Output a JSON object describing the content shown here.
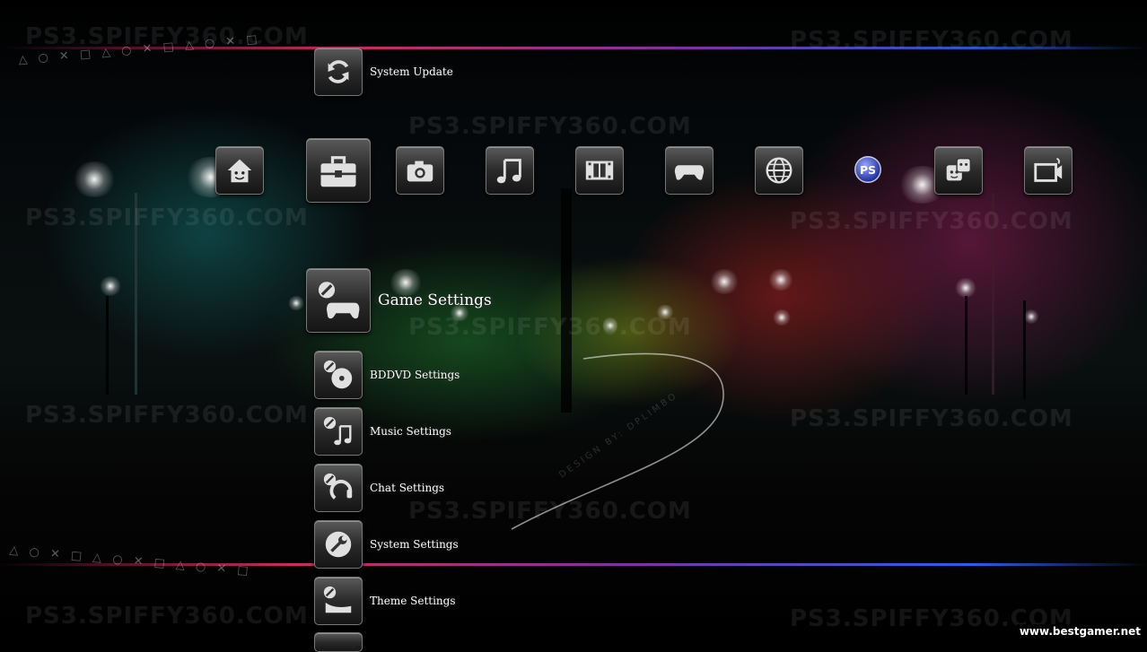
{
  "system_update": {
    "label": "System Update",
    "icon": "refresh-icon"
  },
  "categories": [
    {
      "name": "users",
      "icon": "home-face-icon"
    },
    {
      "name": "settings",
      "icon": "toolbox-icon",
      "selected": true
    },
    {
      "name": "photo",
      "icon": "camera-icon"
    },
    {
      "name": "music",
      "icon": "music-note-icon"
    },
    {
      "name": "video",
      "icon": "film-icon"
    },
    {
      "name": "game",
      "icon": "gamepad-icon"
    },
    {
      "name": "network",
      "icon": "globe-icon"
    },
    {
      "name": "playstation-network",
      "icon": "psn-icon"
    },
    {
      "name": "friends",
      "icon": "dice-face-icon"
    },
    {
      "name": "tv",
      "icon": "tv-icon"
    }
  ],
  "selected_item": {
    "label": "Game Settings",
    "icon": "game-settings-icon"
  },
  "menu_items": [
    {
      "label": "BDDVD Settings",
      "icon": "disc-settings-icon"
    },
    {
      "label": "Music Settings",
      "icon": "music-settings-icon"
    },
    {
      "label": "Chat Settings",
      "icon": "headset-settings-icon"
    },
    {
      "label": "System Settings",
      "icon": "wrench-settings-icon"
    },
    {
      "label": "Theme Settings",
      "icon": "theme-settings-icon"
    }
  ],
  "watermark": "PS3.SPIFFY360.COM",
  "psn_glyph": "PS",
  "design_credit": "DESIGN BY: DPLIMBO",
  "ps_symbols": "△ ○ ✕ □ △ ○ ✕ □ △ ○ ✕ □",
  "site_credit": "www.bestgamer.net",
  "colors": {
    "accent_left": "#e0306a",
    "accent_right": "#2a6aff",
    "text": "#ffffff"
  }
}
